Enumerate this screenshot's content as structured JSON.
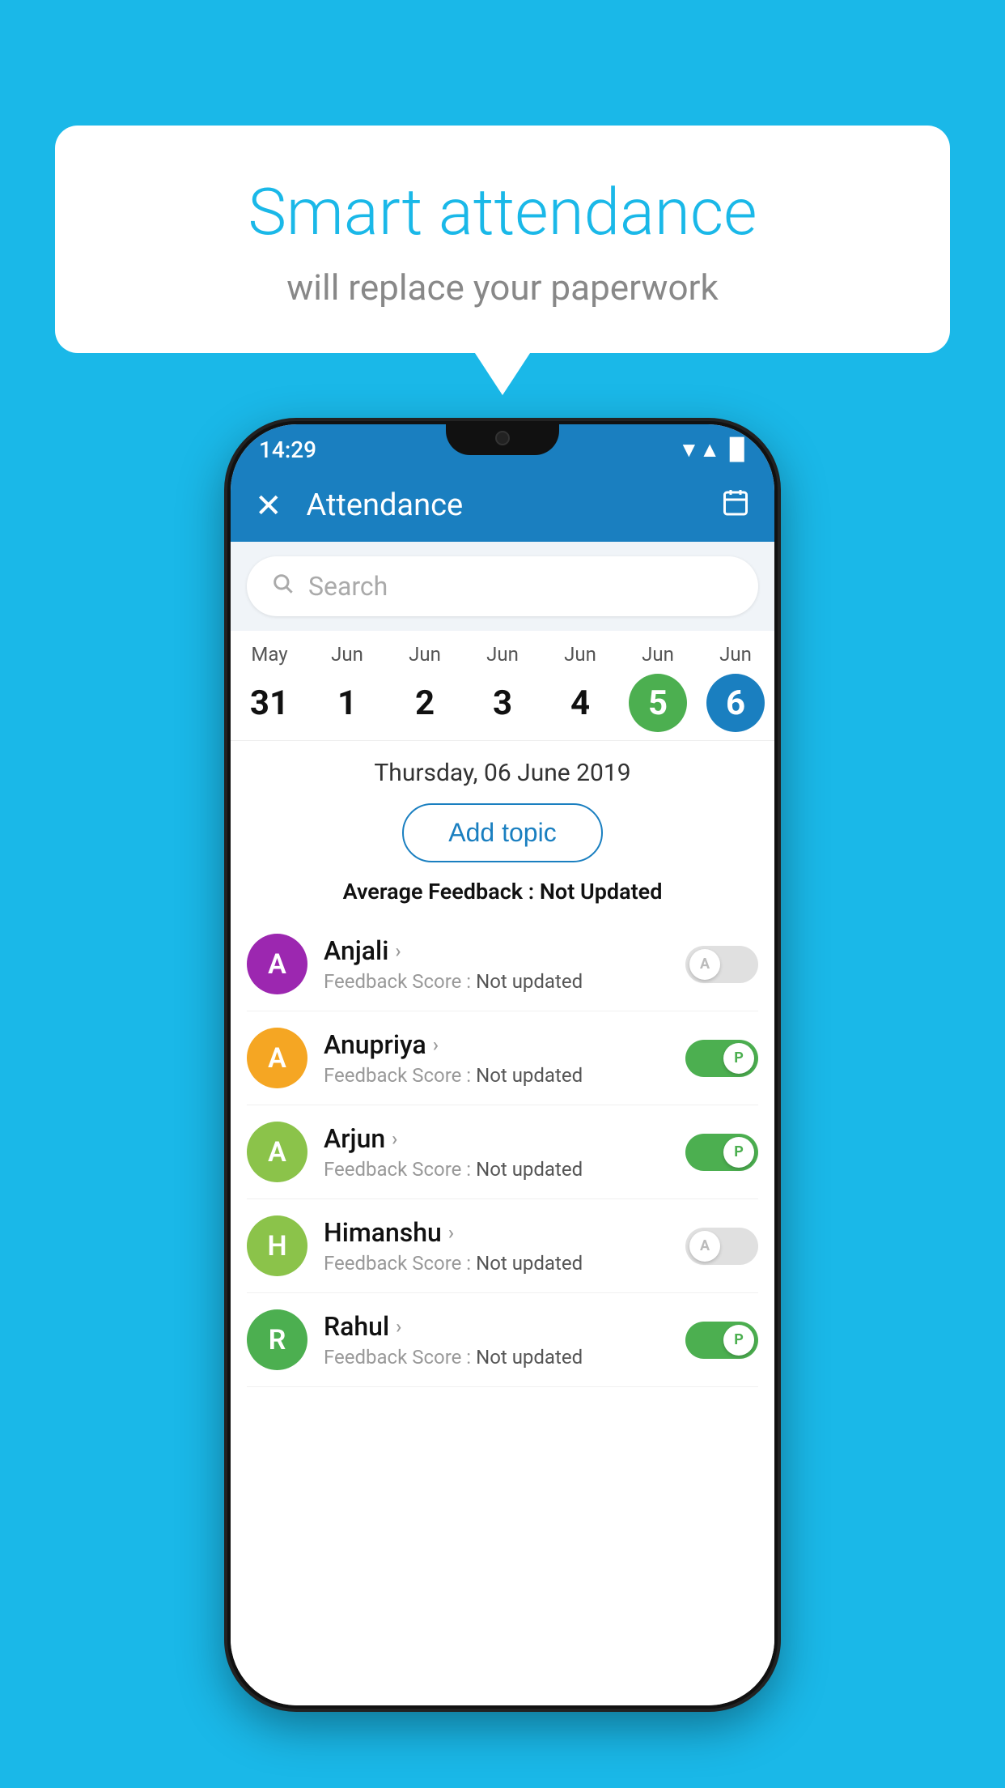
{
  "background_color": "#1ab8e8",
  "speech_bubble": {
    "title": "Smart attendance",
    "subtitle": "will replace your paperwork"
  },
  "status_bar": {
    "time": "14:29",
    "wifi": "▼",
    "signal": "▲",
    "battery": "▉"
  },
  "app_bar": {
    "title": "Attendance",
    "close_label": "✕",
    "calendar_icon": "📅"
  },
  "search": {
    "placeholder": "Search"
  },
  "calendar": {
    "days": [
      {
        "month": "May",
        "date": "31",
        "state": "normal"
      },
      {
        "month": "Jun",
        "date": "1",
        "state": "normal"
      },
      {
        "month": "Jun",
        "date": "2",
        "state": "normal"
      },
      {
        "month": "Jun",
        "date": "3",
        "state": "normal"
      },
      {
        "month": "Jun",
        "date": "4",
        "state": "normal"
      },
      {
        "month": "Jun",
        "date": "5",
        "state": "today"
      },
      {
        "month": "Jun",
        "date": "6",
        "state": "selected"
      }
    ],
    "selected_date_label": "Thursday, 06 June 2019"
  },
  "add_topic_button": "Add topic",
  "average_feedback": {
    "label": "Average Feedback : ",
    "value": "Not Updated"
  },
  "students": [
    {
      "name": "Anjali",
      "avatar_letter": "A",
      "avatar_color": "#9c27b0",
      "feedback_label": "Feedback Score : ",
      "feedback_value": "Not updated",
      "toggle_state": "off",
      "toggle_letter": "A"
    },
    {
      "name": "Anupriya",
      "avatar_letter": "A",
      "avatar_color": "#f5a623",
      "feedback_label": "Feedback Score : ",
      "feedback_value": "Not updated",
      "toggle_state": "on",
      "toggle_letter": "P"
    },
    {
      "name": "Arjun",
      "avatar_letter": "A",
      "avatar_color": "#8bc34a",
      "feedback_label": "Feedback Score : ",
      "feedback_value": "Not updated",
      "toggle_state": "on",
      "toggle_letter": "P"
    },
    {
      "name": "Himanshu",
      "avatar_letter": "H",
      "avatar_color": "#8bc34a",
      "feedback_label": "Feedback Score : ",
      "feedback_value": "Not updated",
      "toggle_state": "off",
      "toggle_letter": "A"
    },
    {
      "name": "Rahul",
      "avatar_letter": "R",
      "avatar_color": "#4caf50",
      "feedback_label": "Feedback Score : ",
      "feedback_value": "Not updated",
      "toggle_state": "on",
      "toggle_letter": "P"
    }
  ]
}
